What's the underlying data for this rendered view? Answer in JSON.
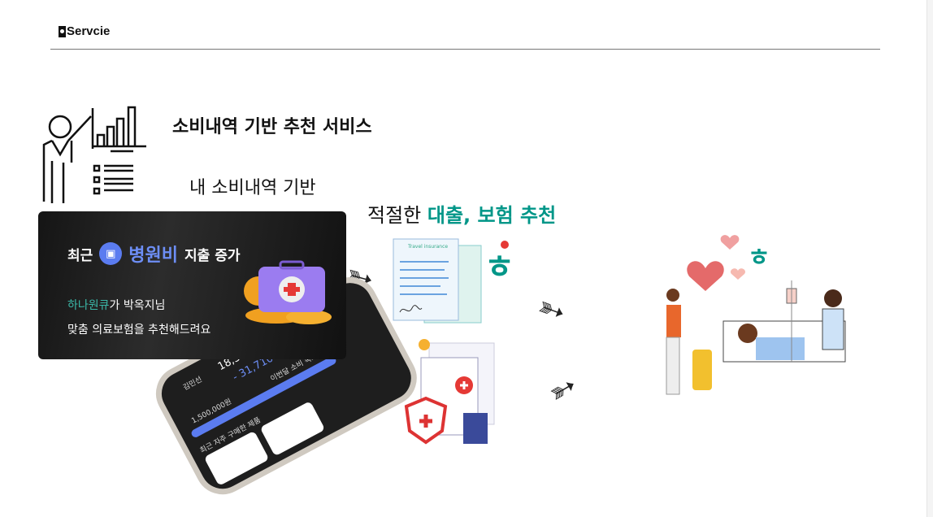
{
  "header": {
    "label": "Servcie"
  },
  "title": "소비내역 기반 추천 서비스",
  "subtitle1": "내 소비내역 기반",
  "subtitle2": {
    "prefix": "적절한 ",
    "highlight": "대출, 보험 추천"
  },
  "card": {
    "line1_prefix": "최근",
    "line1_highlight": "병원비",
    "line1_suffix": "지출 증가",
    "line2_brand": "하나원큐",
    "line2_rest": "가 박옥지님",
    "line3": "맞춤 의료보험을 추천해드려요"
  },
  "phone": {
    "name": "김민선",
    "amount1": "18,320",
    "amount2": "- 31,710",
    "goal": "1,500,000원",
    "goal_label": "이번달 소비 목표",
    "recent_label": "최근 자주 구매한 제품",
    "doc_label": "Travel insurance"
  },
  "colors": {
    "accent": "#009688",
    "blue": "#5b7cf0"
  }
}
